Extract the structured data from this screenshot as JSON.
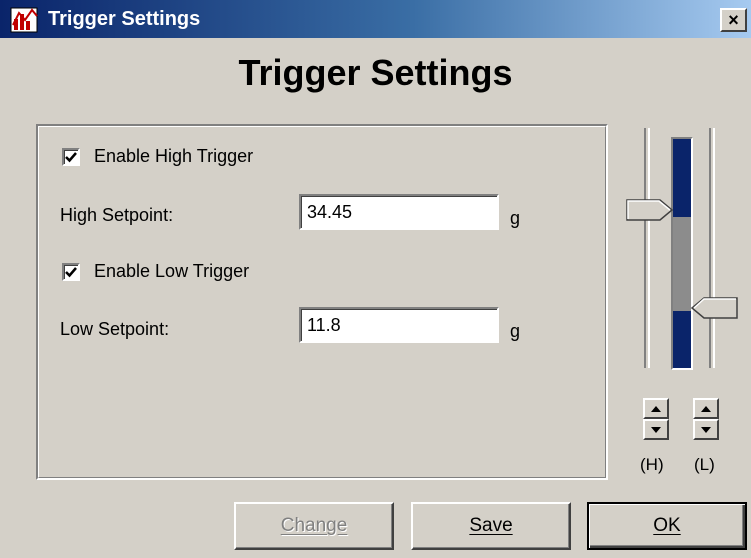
{
  "window": {
    "title": "Trigger Settings",
    "close_label": "×"
  },
  "heading": "Trigger Settings",
  "high": {
    "enable_label": "Enable High Trigger",
    "enabled": true,
    "setpoint_label": "High Setpoint:",
    "value": "34.45",
    "unit": "g"
  },
  "low": {
    "enable_label": "Enable Low Trigger",
    "enabled": true,
    "setpoint_label": "Low Setpoint:",
    "value": "11.8",
    "unit": "g"
  },
  "sliders": {
    "high_label": "(H)",
    "low_label": "(L)",
    "high_level": 0.66,
    "low_level": 0.25
  },
  "buttons": {
    "change": "Change",
    "save": "Save",
    "ok": "OK"
  },
  "colors": {
    "titlebar": "#0a246a",
    "face": "#d4d0c8",
    "bar_fill": "#0a246a"
  },
  "icons": {
    "app": "app-chart-icon",
    "close": "close-icon",
    "check": "check-icon",
    "spin_up": "spin-up-icon",
    "spin_down": "spin-down-icon"
  }
}
